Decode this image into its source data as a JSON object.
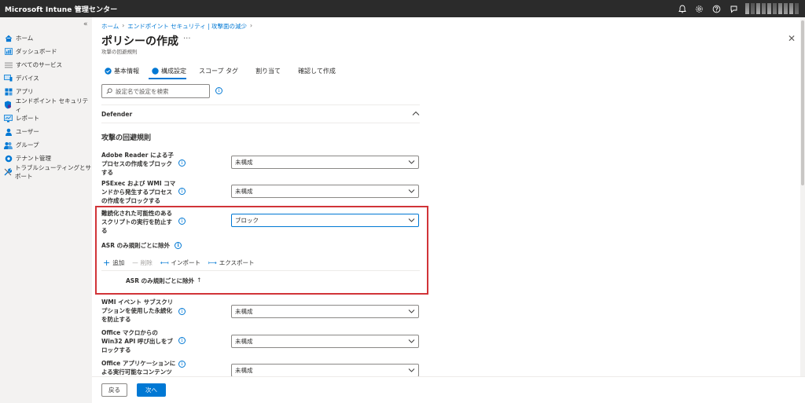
{
  "app": {
    "title": "Microsoft Intune 管理センター"
  },
  "topbar": {
    "icons": [
      "bell-icon",
      "gear-icon",
      "help-icon",
      "feedback-icon"
    ]
  },
  "sidebar": {
    "items": [
      {
        "label": "ホーム",
        "icon": "home-icon"
      },
      {
        "label": "ダッシュボード",
        "icon": "dashboard-icon"
      },
      {
        "label": "すべてのサービス",
        "icon": "list-icon"
      },
      {
        "label": "デバイス",
        "icon": "devices-icon"
      },
      {
        "label": "アプリ",
        "icon": "apps-icon"
      },
      {
        "label": "エンドポイント セキュリティ",
        "icon": "shield-icon"
      },
      {
        "label": "レポート",
        "icon": "report-icon"
      },
      {
        "label": "ユーザー",
        "icon": "user-icon"
      },
      {
        "label": "グループ",
        "icon": "group-icon"
      },
      {
        "label": "テナント管理",
        "icon": "tenant-icon"
      },
      {
        "label": "トラブルシューティングとサポート",
        "icon": "wrench-icon"
      }
    ]
  },
  "breadcrumb": [
    "ホーム",
    "エンドポイント セキュリティ | 攻撃面の減少"
  ],
  "page": {
    "title": "ポリシーの作成",
    "subtitle": "攻撃の回避規則"
  },
  "tabs": [
    {
      "label": "基本情報",
      "state": "done"
    },
    {
      "label": "構成設定",
      "state": "active"
    },
    {
      "label": "スコープ タグ",
      "state": ""
    },
    {
      "label": "割り当て",
      "state": ""
    },
    {
      "label": "確認して作成",
      "state": ""
    }
  ],
  "search": {
    "placeholder": "設定名で設定を検索"
  },
  "section": {
    "title": "Defender"
  },
  "group": {
    "title": "攻撃の回避規則"
  },
  "settings": [
    {
      "label": "Adobe Reader による子プロセスの作成をブロックする",
      "value": "未構成"
    },
    {
      "label": "PSExec および WMI コマンドから発生するプロセスの作成をブロックする",
      "value": "未構成"
    },
    {
      "label": "難読化された可能性のあるスクリプトの実行を防止する",
      "value": "ブロック"
    },
    {
      "label": "WMI イベント サブスクリプションを使用した永続化を防止する",
      "value": "未構成"
    },
    {
      "label": "Office マクロからの Win32 API 呼び出しをブロックする",
      "value": "未構成"
    },
    {
      "label": "Office アプリケーションによる実行可能なコンテンツ",
      "value": "未構成"
    }
  ],
  "exclusions": {
    "label": "ASR のみ規則ごとに除外",
    "actions": {
      "add": "追加",
      "delete": "削除",
      "import": "インポート",
      "export": "エクスポート"
    },
    "column": "ASR のみ規則ごとに除外",
    "sort_glyph": "↑"
  },
  "footer": {
    "back": "戻る",
    "next": "次へ"
  },
  "colors": {
    "accent": "#0078d4",
    "highlight": "#d13438",
    "topbar": "#2b2b2b"
  }
}
